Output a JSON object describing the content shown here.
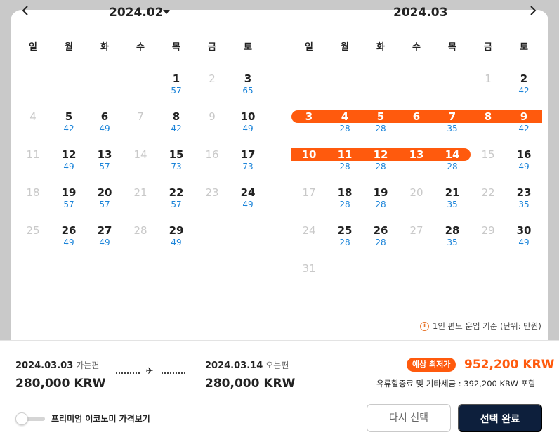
{
  "nav": {
    "prev_icon": "chevron-left-icon",
    "next_icon": "chevron-right-icon"
  },
  "months": [
    {
      "title": "2024.02",
      "has_dropdown": true
    },
    {
      "title": "2024.03",
      "has_dropdown": false
    }
  ],
  "weekdays": [
    "일",
    "월",
    "화",
    "수",
    "목",
    "금",
    "토"
  ],
  "feb": {
    "rows": [
      [
        null,
        null,
        null,
        null,
        {
          "d": "1",
          "f": "57"
        },
        {
          "d": "2",
          "x": true
        },
        {
          "d": "3",
          "f": "65"
        }
      ],
      [
        {
          "d": "4",
          "x": true
        },
        {
          "d": "5",
          "f": "42"
        },
        {
          "d": "6",
          "f": "49"
        },
        {
          "d": "7",
          "x": true
        },
        {
          "d": "8",
          "f": "42"
        },
        {
          "d": "9",
          "x": true
        },
        {
          "d": "10",
          "f": "49"
        }
      ],
      [
        {
          "d": "11",
          "x": true
        },
        {
          "d": "12",
          "f": "49"
        },
        {
          "d": "13",
          "f": "57"
        },
        {
          "d": "14",
          "x": true
        },
        {
          "d": "15",
          "f": "73"
        },
        {
          "d": "16",
          "x": true
        },
        {
          "d": "17",
          "f": "73"
        }
      ],
      [
        {
          "d": "18",
          "x": true
        },
        {
          "d": "19",
          "f": "57"
        },
        {
          "d": "20",
          "f": "57"
        },
        {
          "d": "21",
          "x": true
        },
        {
          "d": "22",
          "f": "57"
        },
        {
          "d": "23",
          "x": true
        },
        {
          "d": "24",
          "f": "49"
        }
      ],
      [
        {
          "d": "25",
          "x": true
        },
        {
          "d": "26",
          "f": "49"
        },
        {
          "d": "27",
          "f": "49"
        },
        {
          "d": "28",
          "x": true
        },
        {
          "d": "29",
          "f": "49"
        },
        null,
        null
      ]
    ]
  },
  "mar": {
    "rows": [
      [
        null,
        null,
        null,
        null,
        null,
        {
          "d": "1",
          "x": true
        },
        {
          "d": "2",
          "f": "42"
        }
      ],
      [
        {
          "d": "3",
          "r": true
        },
        {
          "d": "4",
          "f": "28",
          "r": true
        },
        {
          "d": "5",
          "f": "28",
          "r": true
        },
        {
          "d": "6",
          "r": true
        },
        {
          "d": "7",
          "f": "35",
          "r": true
        },
        {
          "d": "8",
          "r": true
        },
        {
          "d": "9",
          "f": "42",
          "r": true
        }
      ],
      [
        {
          "d": "10",
          "r": true
        },
        {
          "d": "11",
          "f": "28",
          "r": true
        },
        {
          "d": "12",
          "f": "28",
          "r": true
        },
        {
          "d": "13",
          "r": true
        },
        {
          "d": "14",
          "f": "28",
          "r": true
        },
        {
          "d": "15",
          "x": true
        },
        {
          "d": "16",
          "f": "49"
        }
      ],
      [
        {
          "d": "17",
          "x": true
        },
        {
          "d": "18",
          "f": "28"
        },
        {
          "d": "19",
          "f": "28"
        },
        {
          "d": "20",
          "x": true
        },
        {
          "d": "21",
          "f": "35"
        },
        {
          "d": "22",
          "x": true
        },
        {
          "d": "23",
          "f": "35"
        }
      ],
      [
        {
          "d": "24",
          "x": true
        },
        {
          "d": "25",
          "f": "28"
        },
        {
          "d": "26",
          "f": "28"
        },
        {
          "d": "27",
          "x": true
        },
        {
          "d": "28",
          "f": "35"
        },
        {
          "d": "29",
          "x": true
        },
        {
          "d": "30",
          "f": "49"
        }
      ],
      [
        {
          "d": "31",
          "x": true
        },
        null,
        null,
        null,
        null,
        null,
        null
      ]
    ]
  },
  "colors": {
    "range": "#ff5a0d",
    "fare": "#1b84d9",
    "disabled": "#c9c9c9",
    "primary_button": "#0d1f3c"
  },
  "notice": {
    "icon": "info-icon",
    "text": "1인 편도 운임 기준 (단위: 만원)"
  },
  "summary": {
    "departure": {
      "date": "2024.03.03",
      "tag": "가는편",
      "price": "280,000 KRW"
    },
    "return": {
      "date": "2024.03.14",
      "tag": "오는편",
      "price": "280,000 KRW"
    },
    "plane_icon": "airplane-icon",
    "badge": "예상 최저가",
    "total": "952,200 KRW",
    "tax_note": "유류할증료 및 기타세금 : 392,200 KRW 포함"
  },
  "premium": {
    "label": "프리미엄 이코노미 가격보기",
    "enabled": false
  },
  "buttons": {
    "reset": "다시 선택",
    "done": "선택 완료"
  }
}
